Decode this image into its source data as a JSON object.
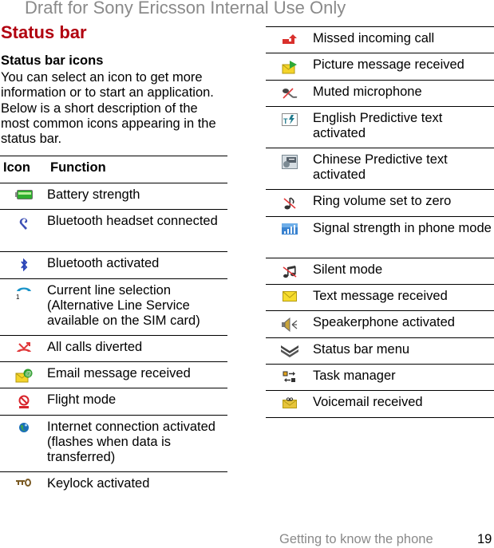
{
  "watermark": "Draft for Sony Ericsson Internal Use Only",
  "title": "Status bar",
  "subheading": "Status bar icons",
  "intro": "You can select an icon to get more information or to start an application. Below is a short description of the most common icons appearing in the status bar.",
  "table_left": {
    "header": {
      "icon": "Icon",
      "function": "Function"
    },
    "rows": [
      {
        "icon": "battery-icon",
        "label": "Battery strength"
      },
      {
        "icon": "bluetooth-headset-icon",
        "label": "Bluetooth headset connected"
      },
      {
        "icon": "bluetooth-icon",
        "label": "Bluetooth activated"
      },
      {
        "icon": "line-selection-icon",
        "label": "Current line selection (Alternative Line Service available on the SIM card)"
      },
      {
        "icon": "calls-diverted-icon",
        "label": "All calls diverted"
      },
      {
        "icon": "email-received-icon",
        "label": "Email message received"
      },
      {
        "icon": "flight-mode-icon",
        "label": "Flight mode"
      },
      {
        "icon": "internet-globe-icon",
        "label": "Internet connection activated (flashes when data is transferred)"
      },
      {
        "icon": "keylock-icon",
        "label": "Keylock activated"
      }
    ]
  },
  "table_right": {
    "rows": [
      {
        "icon": "missed-call-icon",
        "label": "Missed incoming call"
      },
      {
        "icon": "picture-message-icon",
        "label": "Picture message received"
      },
      {
        "icon": "muted-microphone-icon",
        "label": "Muted microphone"
      },
      {
        "icon": "english-predictive-icon",
        "label": "English Predictive text activated"
      },
      {
        "icon": "chinese-predictive-icon",
        "label": "Chinese Predictive text activated"
      },
      {
        "icon": "ring-volume-zero-icon",
        "label": "Ring volume set to zero"
      },
      {
        "icon": "signal-strength-icon",
        "label": "Signal strength in phone mode"
      },
      {
        "icon": "silent-mode-icon",
        "label": "Silent mode"
      },
      {
        "icon": "text-message-icon",
        "label": "Text message received"
      },
      {
        "icon": "speakerphone-icon",
        "label": "Speakerphone activated"
      },
      {
        "icon": "status-bar-menu-icon",
        "label": "Status bar menu"
      },
      {
        "icon": "task-manager-icon",
        "label": "Task manager"
      },
      {
        "icon": "voicemail-icon",
        "label": "Voicemail received"
      }
    ]
  },
  "footer": {
    "section": "Getting to know the phone",
    "page_number": "19"
  }
}
